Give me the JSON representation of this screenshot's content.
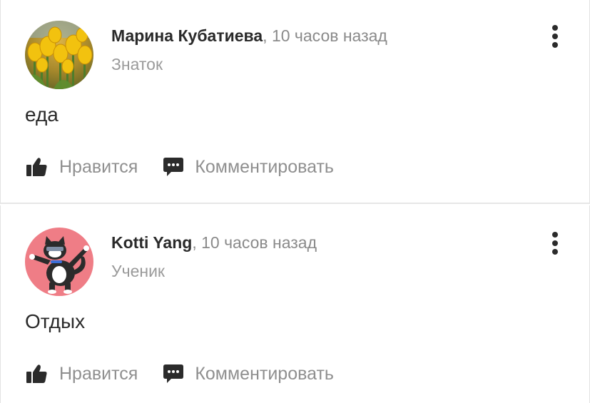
{
  "posts": [
    {
      "author": "Марина Кубатиева",
      "separator": ",",
      "time": "10 часов назад",
      "rank": "Знаток",
      "text": "еда",
      "avatar": "tulips-photo",
      "like_label": "Нравится",
      "comment_label": "Комментировать"
    },
    {
      "author": "Kotti Yang",
      "separator": ",",
      "time": "10 часов назад",
      "rank": "Ученик",
      "text": "Отдых",
      "avatar": "dabbing-cat-illustration",
      "like_label": "Нравится",
      "comment_label": "Комментировать"
    }
  ],
  "icons": {
    "like": "thumbs-up-icon",
    "comment": "comment-bubble-icon",
    "menu": "more-vertical-icon"
  },
  "colors": {
    "text": "#2b2b2b",
    "muted": "#8f8f8f",
    "divider": "#e6e6e6",
    "avatar_pink": "#ef7d86"
  }
}
